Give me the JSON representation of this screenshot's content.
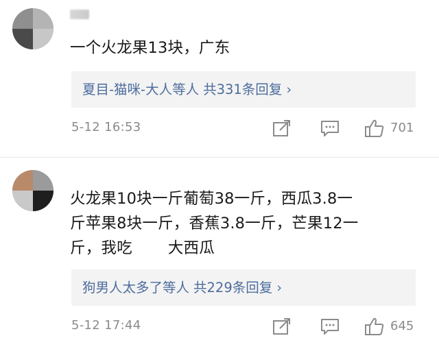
{
  "comments": [
    {
      "text": "一个火龙果13块，广东",
      "reply": {
        "users": "夏目-猫咪-大人等人",
        "count": "共331条回复",
        "chevron": "›"
      },
      "timestamp": "5-12 16:53",
      "likes": "701",
      "icons": [
        "share-icon",
        "comment-icon",
        "like-icon"
      ]
    },
    {
      "text_line1": "火龙果10块一斤葡萄38一斤，西瓜3.8一",
      "text_line2": "斤苹果8块一斤，香蕉3.8一斤，芒果12一",
      "text_line3a": "斤，我吃",
      "text_line3b": "大西瓜",
      "reply": {
        "users": "狗男人太多了等人",
        "count": "共229条回复",
        "chevron": "›"
      },
      "timestamp": "5-12 17:44",
      "likes": "645",
      "icons": [
        "share-icon",
        "comment-icon",
        "like-icon"
      ]
    }
  ],
  "colors": {
    "link": "#4d6c9e",
    "meta": "#8a8a8a",
    "reply_bg": "#f3f3f3"
  }
}
